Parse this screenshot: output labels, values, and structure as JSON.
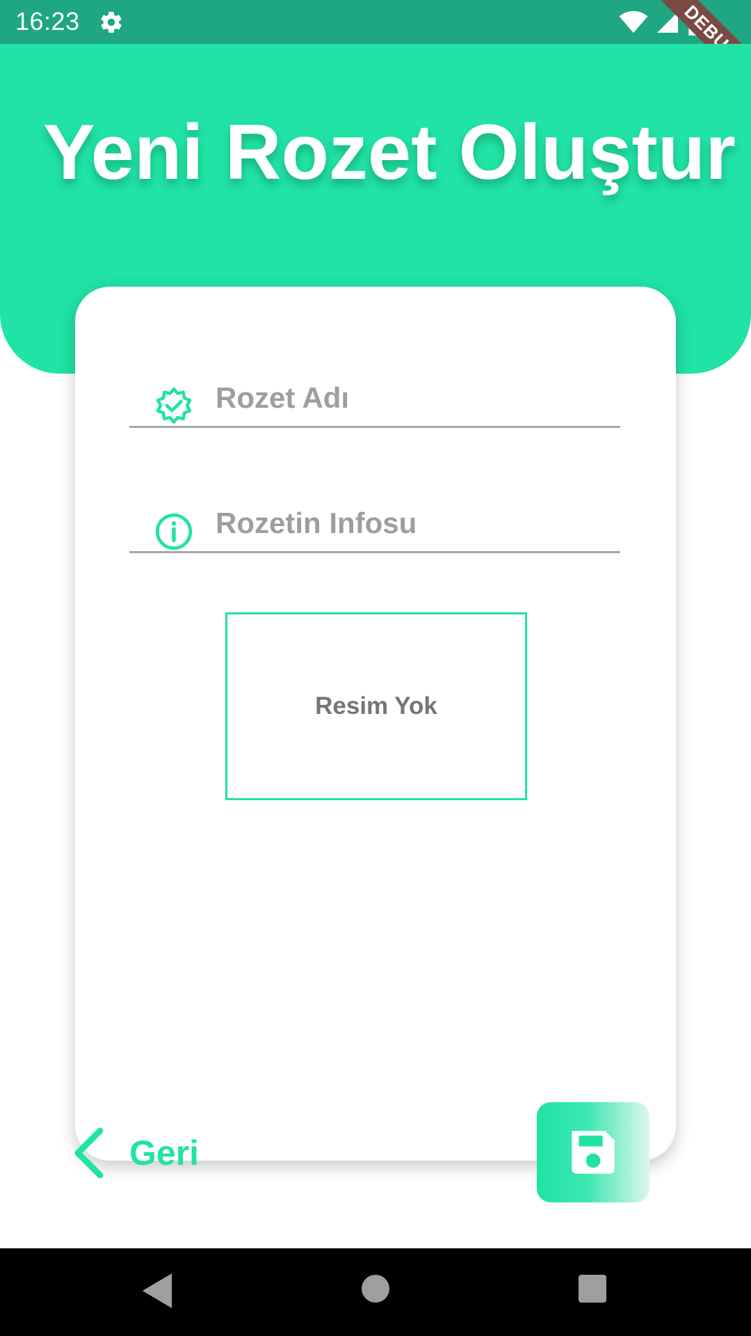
{
  "status_bar": {
    "time": "16:23",
    "debug_label": "DEBUG"
  },
  "header": {
    "title": "Yeni Rozet Oluştur"
  },
  "form": {
    "badge_name": {
      "placeholder": "Rozet Adı",
      "value": ""
    },
    "badge_info": {
      "placeholder": "Rozetin Infosu",
      "value": ""
    },
    "image_placeholder": "Resim Yok"
  },
  "footer": {
    "back_label": "Geri"
  },
  "colors": {
    "accent": "#20e3a5",
    "status_bar": "#1ea782",
    "field_line": "#a6a6a6",
    "hint_text": "#9e9e9e"
  },
  "icons": {
    "status": [
      "gear-icon",
      "wifi-icon",
      "signal-icon",
      "battery-icon"
    ],
    "fields": [
      "verified-badge-icon",
      "info-icon"
    ],
    "actions": [
      "chevron-left-icon",
      "save-icon"
    ],
    "nav": [
      "nav-back-icon",
      "nav-home-icon",
      "nav-recents-icon"
    ]
  }
}
